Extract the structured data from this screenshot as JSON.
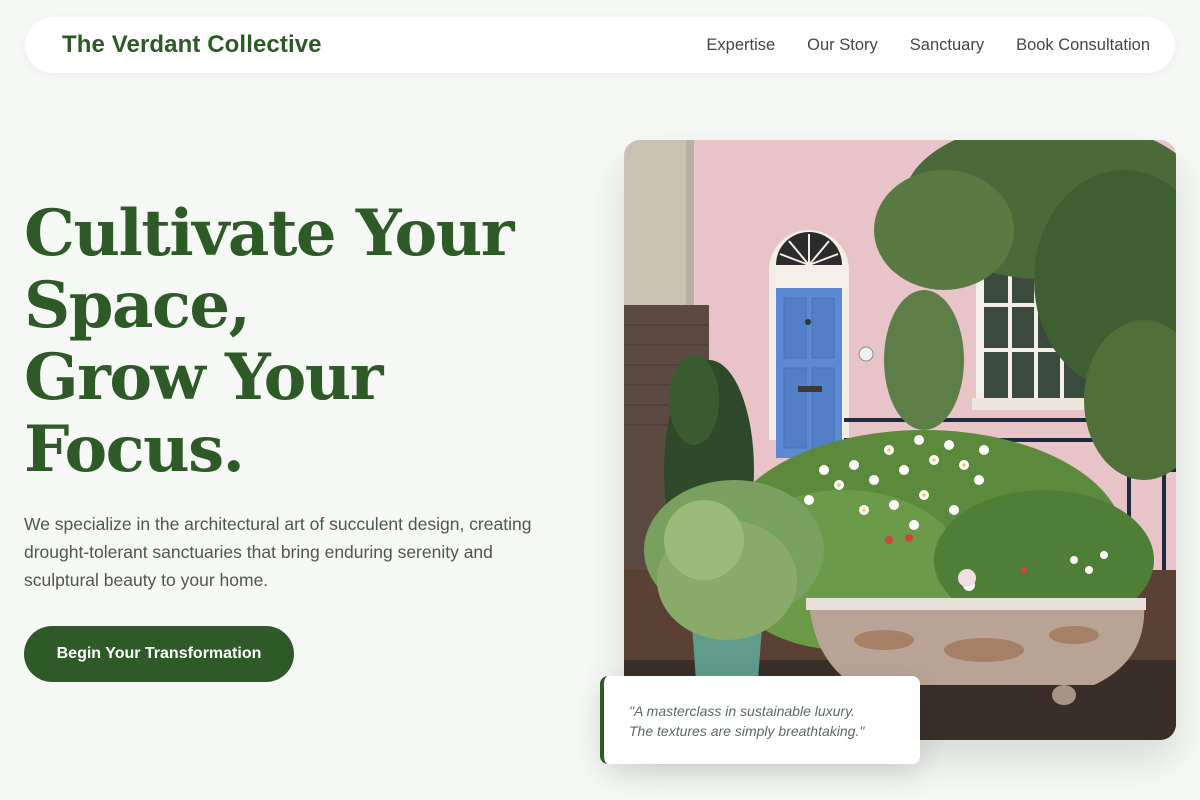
{
  "nav": {
    "brand": "The Verdant Collective",
    "links": [
      "Expertise",
      "Our Story",
      "Sanctuary",
      "Book Consultation"
    ]
  },
  "hero": {
    "title_lines": [
      "Cultivate Your",
      "Space,",
      "Grow Your",
      "Focus."
    ],
    "description": "We specialize in the architectural art of succulent design, creating drought-tolerant sanctuaries that bring enduring serenity and sculptural beauty to your home.",
    "cta_label": "Begin Your Transformation"
  },
  "quote": {
    "line1": "\"A masterclass in sustainable luxury.",
    "line2": "The textures are simply breathtaking.\""
  },
  "colors": {
    "brand_green": "#2d5a27",
    "background": "#f5f8f5",
    "text_muted": "#4a5a4c"
  }
}
